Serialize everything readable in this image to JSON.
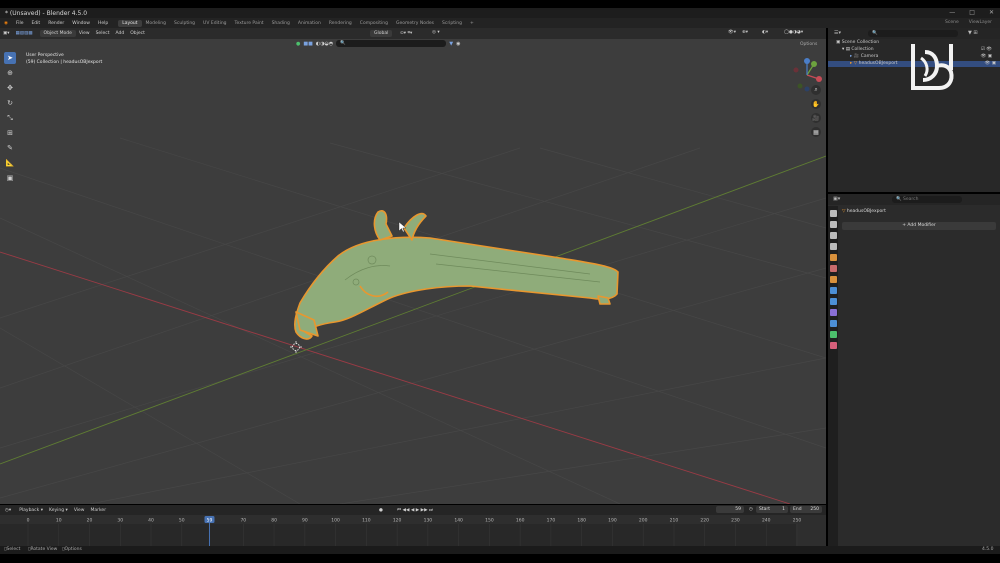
{
  "window": {
    "title": "* (Unsaved) - Blender 4.5.0",
    "controls": [
      "—",
      "□",
      "✕"
    ]
  },
  "menubar": {
    "menus": [
      "File",
      "Edit",
      "Render",
      "Window",
      "Help"
    ],
    "workspaces": [
      "Layout",
      "Modeling",
      "Sculpting",
      "UV Editing",
      "Texture Paint",
      "Shading",
      "Animation",
      "Rendering",
      "Compositing",
      "Geometry Nodes",
      "Scripting"
    ],
    "active_workspace": "Layout",
    "add_tab": "+",
    "scene_label": "Scene",
    "viewlayer_label": "ViewLayer"
  },
  "viewport": {
    "mode": "Object Mode",
    "menus": [
      "View",
      "Select",
      "Add",
      "Object"
    ],
    "transform_orientation": "Global",
    "options_label": "Options",
    "info_line1": "User Perspective",
    "info_line2": "(59) Collection | headusOBJexport"
  },
  "outliner": {
    "search_placeholder": "",
    "rows": [
      {
        "label": "Scene Collection",
        "indent": 0,
        "selected": false
      },
      {
        "label": "Collection",
        "indent": 1,
        "selected": false
      },
      {
        "label": "Camera",
        "indent": 2,
        "selected": false
      },
      {
        "label": "headusOBJexport",
        "indent": 2,
        "selected": true
      }
    ]
  },
  "properties": {
    "search_placeholder": "Search",
    "object_name": "headusOBJexport",
    "add_modifier_label": "Add Modifier",
    "tab_colors": [
      "#bdbdbd",
      "#bdbdbd",
      "#bdbdbd",
      "#bdbdbd",
      "#d9913c",
      "#c86b6b",
      "#d9913c",
      "#4c8fd6",
      "#4c8fd6",
      "#8a6fd6",
      "#4c8fd6",
      "#4cbf6c",
      "#d65f7a"
    ]
  },
  "timeline": {
    "menus": [
      "Playback",
      "Keying",
      "View",
      "Marker"
    ],
    "current_frame": "59",
    "start_label": "Start",
    "start_value": "1",
    "end_label": "End",
    "end_value": "250",
    "ticks": [
      "0",
      "10",
      "20",
      "30",
      "40",
      "50",
      "59",
      "70",
      "80",
      "90",
      "100",
      "110",
      "120",
      "130",
      "140",
      "150",
      "160",
      "170",
      "180",
      "190",
      "200",
      "210",
      "220",
      "230",
      "240",
      "250"
    ]
  },
  "statusbar": {
    "items": [
      "Select",
      "Rotate View",
      "Options"
    ],
    "version": "4.5.0"
  },
  "colors": {
    "accent": "#4772b3",
    "model_fill": "#8fac7a",
    "selection_outline": "#e8972f",
    "playhead": "#4772b3"
  }
}
